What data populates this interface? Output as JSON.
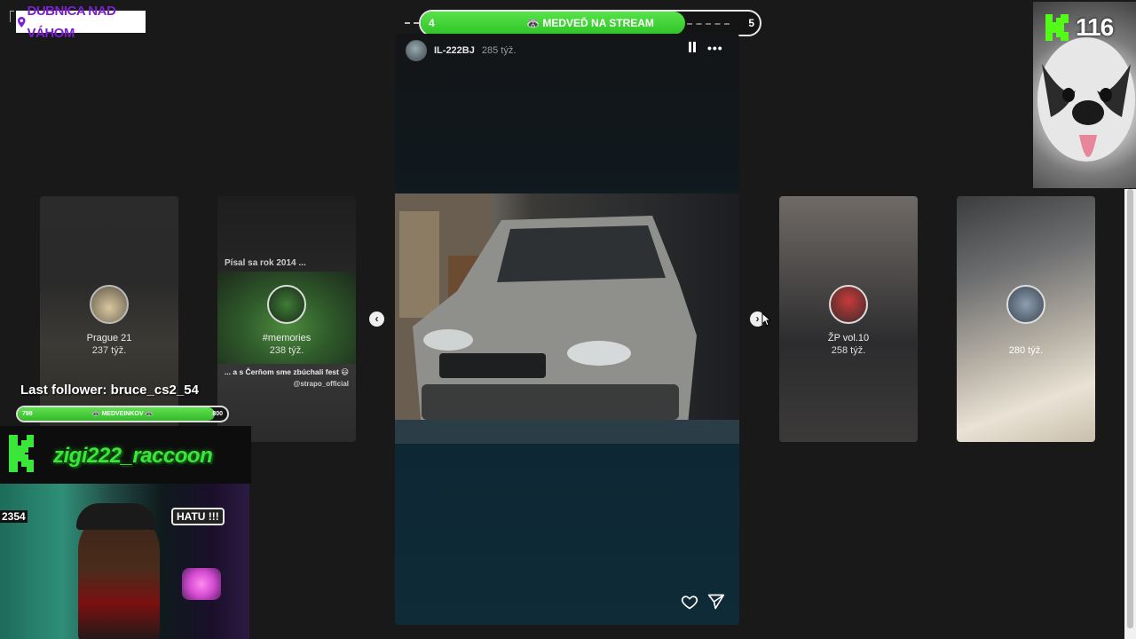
{
  "location": {
    "label": "DUBNICA NAD VÁHOM",
    "icon": "map-pin-icon",
    "color": "#7b1fd1"
  },
  "goal": {
    "left_value": "4",
    "label": "🦝 MEDVEĎ NA STREAM",
    "right_value": "5",
    "progress_fraction": 0.78,
    "fill_color": "#3fd233"
  },
  "story": {
    "username": "IL-222BJ",
    "time": "285 týž.",
    "more_label": "•••",
    "icons": [
      "pause-icon",
      "more-icon",
      "heart-icon",
      "send-icon"
    ]
  },
  "cards": [
    {
      "title": "Prague 21",
      "time": "237 týž."
    },
    {
      "title": "#memories",
      "time": "238 týž.",
      "top_text": "Písal sa rok 2014 ...",
      "caption": "... a s Čerňom sme zbúchali fest 😃",
      "credit": "@strapo_official"
    },
    {
      "title": "ŽP vol.10",
      "time": "258 týž."
    },
    {
      "title": "",
      "time": "280 týž."
    }
  ],
  "nav": {
    "prev": "‹",
    "next": "›"
  },
  "overlay": {
    "kick_count": "116",
    "last_follower": "Last follower: bruce_cs2_54",
    "follower_bar": {
      "left": "798",
      "label": "🦝 MEDVEINKOV 🦝",
      "right": "800",
      "progress_fraction": 0.94
    },
    "channel_name": "zigi222_raccoon",
    "webcam_counter": "2354",
    "webcam_sign": "HATU !!!"
  },
  "colors": {
    "kick_green": "#53fc18",
    "background": "#191919"
  }
}
